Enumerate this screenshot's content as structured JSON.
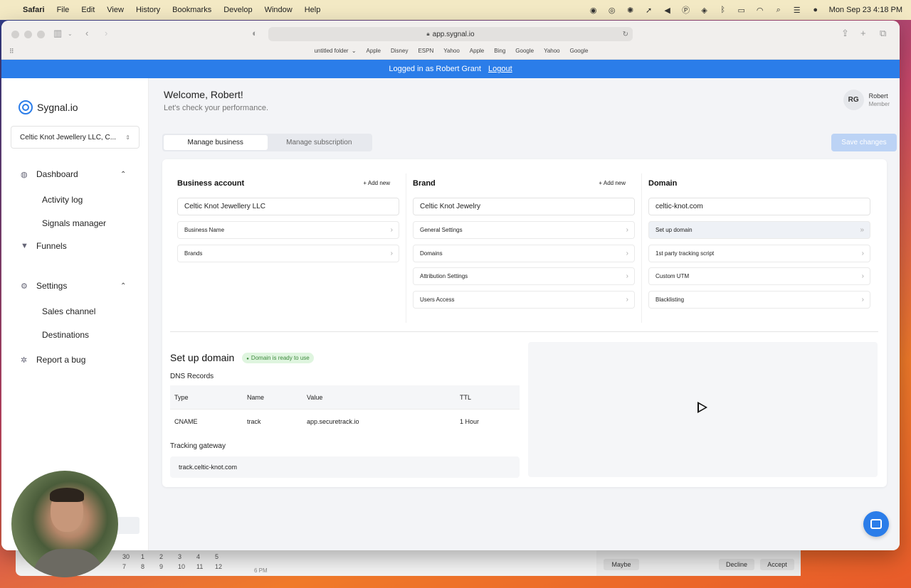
{
  "menubar": {
    "app": "Safari",
    "items": [
      "File",
      "Edit",
      "View",
      "History",
      "Bookmarks",
      "Develop",
      "Window",
      "Help"
    ],
    "clock": "Mon Sep 23  4:18 PM",
    "status_icons": [
      "zoom-icon",
      "eye-icon",
      "gear-icon",
      "feather-icon",
      "volume-icon",
      "p-icon",
      "layers-icon",
      "bluetooth-icon",
      "battery-icon",
      "wifi-icon",
      "search-icon",
      "control-center-icon",
      "siri-icon"
    ]
  },
  "browser": {
    "url": "app.sygnal.io",
    "favorites": [
      "untitled folder",
      "Apple",
      "Disney",
      "ESPN",
      "Yahoo",
      "Apple",
      "Bing",
      "Google",
      "Yahoo",
      "Google"
    ]
  },
  "banner": {
    "text": "Logged in as Robert Grant",
    "logout": "Logout"
  },
  "sidebar": {
    "brand": "Sygnal.io",
    "business_select": "Celtic Knot Jewellery LLC, C...",
    "dashboard": "Dashboard",
    "activity_log": "Activity log",
    "signals_manager": "Signals manager",
    "funnels": "Funnels",
    "settings": "Settings",
    "sales_channel": "Sales channel",
    "destinations": "Destinations",
    "report_bug": "Report a bug"
  },
  "header": {
    "welcome": "Welcome, Robert!",
    "subtitle": "Let's check your performance.",
    "user_initials": "RG",
    "user_name": "Robert",
    "user_role": "Member"
  },
  "tabs": [
    "Manage business",
    "Manage subscription"
  ],
  "save_button": "Save changes",
  "columns": {
    "business": {
      "title": "Business account",
      "add": "+ Add new",
      "selected": "Celtic Knot Jewellery LLC",
      "items": [
        "Business Name",
        "Brands"
      ]
    },
    "brand": {
      "title": "Brand",
      "add": "+ Add new",
      "selected": "Celtic Knot Jewelry",
      "items": [
        "General Settings",
        "Domains",
        "Attribution Settings",
        "Users Access"
      ]
    },
    "domain": {
      "title": "Domain",
      "selected": "celtic-knot.com",
      "items": [
        "Set up domain",
        "1st party tracking script",
        "Custom UTM",
        "Blacklisting"
      ]
    }
  },
  "setup": {
    "title": "Set up domain",
    "status": "Domain is ready to use",
    "dns_label": "DNS Records",
    "headers": [
      "Type",
      "Name",
      "Value",
      "TTL"
    ],
    "row": [
      "CNAME",
      "track",
      "app.securetrack.io",
      "1 Hour"
    ],
    "gateway_label": "Tracking gateway",
    "gateway_value": "track.celtic-knot.com"
  },
  "background": {
    "calendar_nums": [
      "30",
      "1",
      "2",
      "3",
      "4",
      "5",
      "7",
      "8",
      "9",
      "10",
      "11",
      "12"
    ],
    "time_label": "6 PM",
    "notif_buttons": [
      "Maybe",
      "Decline",
      "Accept"
    ]
  }
}
